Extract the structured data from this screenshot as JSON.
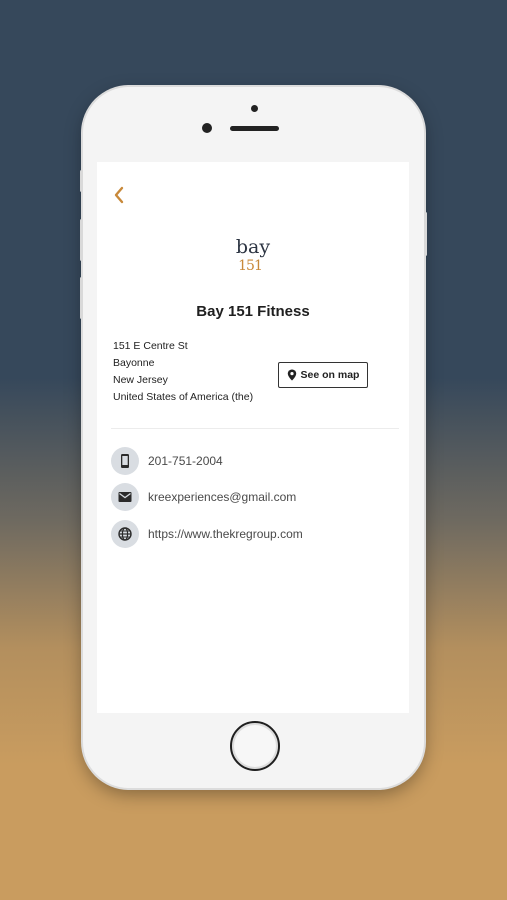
{
  "app": {
    "logo": {
      "top": "bay",
      "bottom": "151"
    },
    "venue_name": "Bay 151 Fitness",
    "address": {
      "street": "151 E Centre St",
      "city": "Bayonne",
      "state": "New Jersey",
      "country": "United States of America (the)"
    },
    "map_button_label": "See on map",
    "contacts": [
      {
        "icon": "phone-icon",
        "value": "201-751-2004"
      },
      {
        "icon": "mail-icon",
        "value": "kreexperiences@gmail.com"
      },
      {
        "icon": "globe-icon",
        "value": "https://www.thekregroup.com"
      }
    ]
  },
  "colors": {
    "accent": "#c8893a",
    "icon_circle": "#d9dde2",
    "background_top": "#36485b",
    "background_bottom": "#c99c5f"
  }
}
